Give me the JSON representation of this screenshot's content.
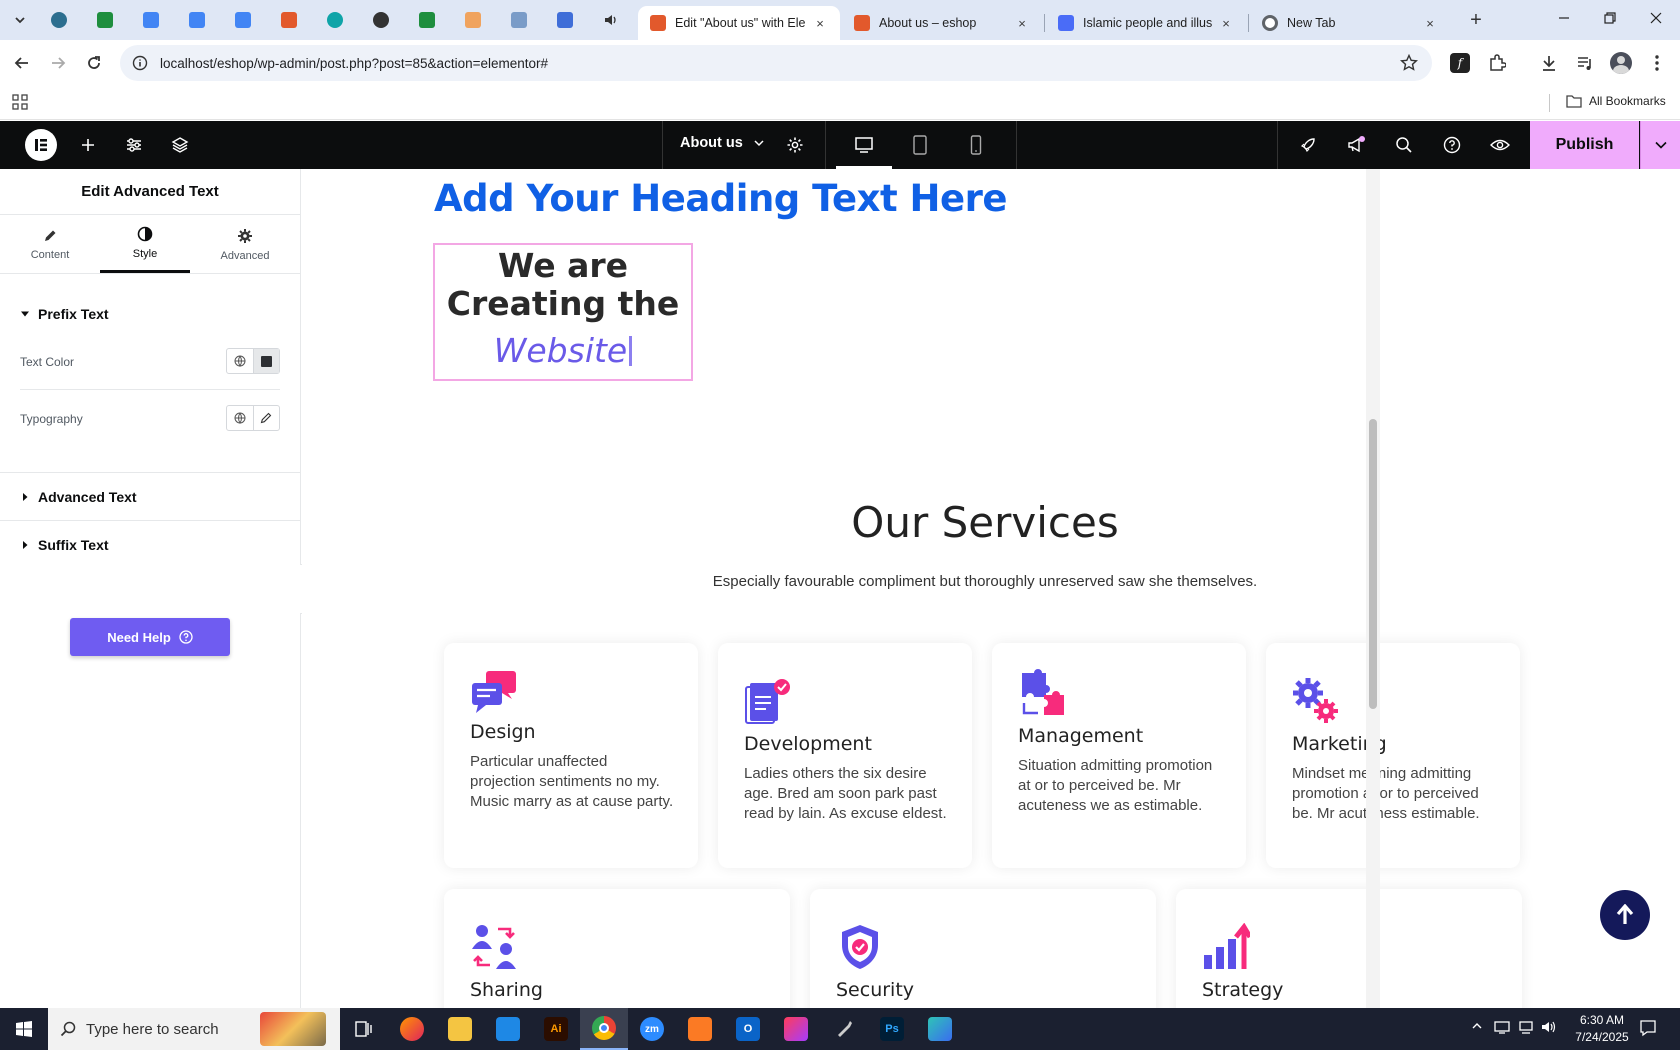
{
  "browser": {
    "tabs": [
      {
        "title": "Edit \"About us\" with Elem",
        "active": true,
        "favicon_color": "#e2592c"
      },
      {
        "title": "About us – eshop",
        "active": false,
        "favicon_color": "#e2592c"
      },
      {
        "title": "Islamic people and illustra",
        "active": false,
        "favicon_color": "#4a6cf7"
      },
      {
        "title": "New Tab",
        "active": false,
        "favicon_color": "#5f6368"
      }
    ],
    "pinned_tabs": [
      "wordpress-icon",
      "sheets-icon",
      "docs-icon",
      "docs-icon",
      "docs-icon",
      "xampp-icon",
      "bing-icon",
      "chatgpt-icon",
      "sheets-icon",
      "java-icon",
      "grid-icon",
      "forms-icon",
      "speaker-icon"
    ],
    "tab_close": "×",
    "new_tab": "+",
    "url": "localhost/eshop/wp-admin/post.php?post=85&action=elementor#",
    "bookmarks_label": "All Bookmarks"
  },
  "elementor": {
    "page_name": "About us",
    "publish_label": "Publish",
    "panel": {
      "title": "Edit Advanced Text",
      "tabs": [
        "Content",
        "Style",
        "Advanced"
      ],
      "active_tab": "Style",
      "sections": {
        "prefix": "Prefix Text",
        "advanced": "Advanced Text",
        "suffix": "Suffix Text"
      },
      "controls": {
        "text_color": "Text Color",
        "typography": "Typography"
      },
      "need_help": "Need Help"
    }
  },
  "canvas": {
    "heading": "Add Your Heading Text Here",
    "advanced_text": {
      "prefix": "We are Creating the",
      "animated": "Website"
    },
    "services_title": "Our Services",
    "services_subtitle": "Especially favourable compliment but thoroughly unreserved saw she themselves.",
    "services": [
      {
        "icon": "chat-icon",
        "title": "Design",
        "text": "Particular unaffected projection sentiments no my. Music marry as at cause party."
      },
      {
        "icon": "document-icon",
        "title": "Development",
        "text": "Ladies others the six desire age. Bred am soon park past read by lain. As excuse eldest."
      },
      {
        "icon": "puzzle-icon",
        "title": "Management",
        "text": "Situation admitting promotion at or to perceived be. Mr acuteness we as estimable."
      },
      {
        "icon": "gears-icon",
        "title": "Marketing",
        "text": "Mindset meaning admitting promotion at or to perceived be. Mr acuteness estimable."
      },
      {
        "icon": "people-exchange-icon",
        "title": "Sharing",
        "text": ""
      },
      {
        "icon": "shield-icon",
        "title": "Security",
        "text": ""
      },
      {
        "icon": "growth-chart-icon",
        "title": "Strategy",
        "text": ""
      }
    ],
    "colors": {
      "heading": "#1060e5",
      "accent_purple": "#6a5ae8",
      "accent_pink": "#f72b7c",
      "publish": "#f0abfc"
    }
  },
  "taskbar": {
    "search_placeholder": "Type here to search",
    "time": "6:30 AM",
    "date": "7/24/2025"
  }
}
